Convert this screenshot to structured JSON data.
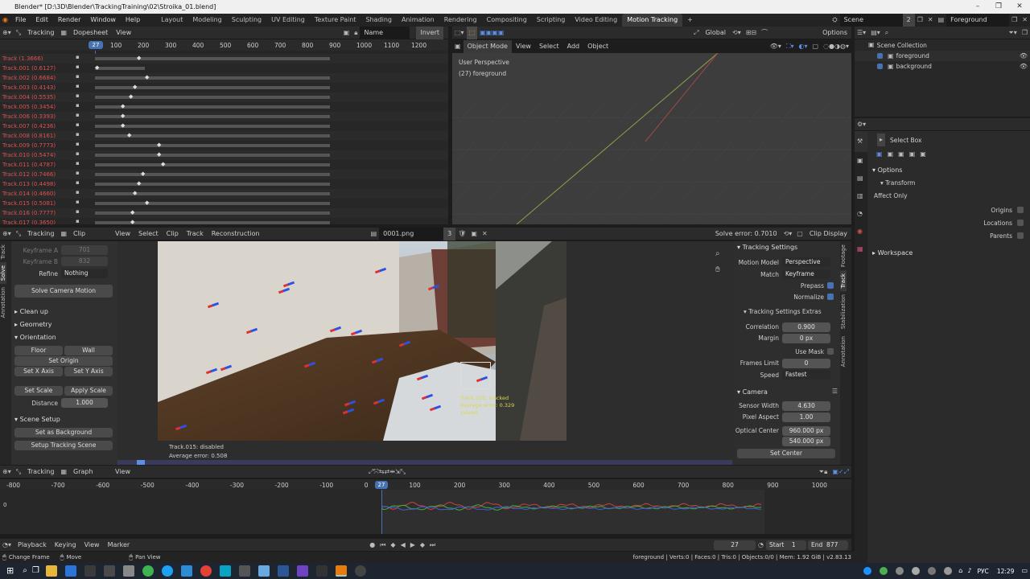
{
  "window": {
    "title": "Blender* [D:\\3D\\Blender\\TrackingTraining\\02\\Stroika_01.blend]"
  },
  "menu": [
    "File",
    "Edit",
    "Render",
    "Window",
    "Help"
  ],
  "workspaces": [
    "Layout",
    "Modeling",
    "Sculpting",
    "UV Editing",
    "Texture Paint",
    "Shading",
    "Animation",
    "Rendering",
    "Compositing",
    "Scripting",
    "Video Editing",
    "Motion Tracking"
  ],
  "active_workspace": "Motion Tracking",
  "scene": {
    "label": "Scene",
    "count": "2",
    "viewlayer": "Foreground"
  },
  "dopesheet": {
    "mode": "Tracking",
    "view": "Dopesheet",
    "view_menu": "View",
    "sort": "Name",
    "invert": "Invert",
    "frame_current": "27",
    "ticks": [
      "100",
      "200",
      "300",
      "400",
      "500",
      "600",
      "700",
      "800",
      "900",
      "1000",
      "1100",
      "1200"
    ],
    "tracks": [
      "Track (1.3666)",
      "Track.001 (0.6127)",
      "Track.002 (0.6684)",
      "Track.003 (0.4143)",
      "Track.004 (0.5535)",
      "Track.005 (0.3454)",
      "Track.006 (0.3393)",
      "Track.007 (0.4236)",
      "Track.008 (0.8161)",
      "Track.009 (0.7773)",
      "Track.010 (0.5474)",
      "Track.011 (0.4787)",
      "Track.012 (0.7466)",
      "Track.013 (0.4498)",
      "Track.014 (0.4660)",
      "Track.015 (0.5081)",
      "Track.016 (0.7777)",
      "Track.017 (0.3650)"
    ]
  },
  "viewport3d": {
    "mode": "Object Mode",
    "menus": [
      "View",
      "Select",
      "Add",
      "Object"
    ],
    "orientation": "Global",
    "options": "Options",
    "perspective_label": "User Perspective",
    "active_object": "(27) foreground"
  },
  "outliner": {
    "collection": "Scene Collection",
    "items": [
      "foreground",
      "background"
    ]
  },
  "properties": {
    "tool": "Select Box",
    "options_label": "Options",
    "transform_label": "Transform",
    "affect_only": "Affect Only",
    "origins": "Origins",
    "locations": "Locations",
    "parents": "Parents",
    "workspace": "Workspace"
  },
  "clip_editor": {
    "mode": "Tracking",
    "view": "Clip",
    "menus": [
      "View",
      "Select",
      "Clip",
      "Track",
      "Reconstruction"
    ],
    "clip_name": "0001.png",
    "users": "3",
    "solve_error": "Solve error: 0.7010",
    "display": "Clip Display",
    "overlay_track": "Track.015: disabled",
    "overlay_avg": "Average error: 0.508",
    "marker_label_1": "Track.025: tracked",
    "marker_label_2": "Average error: 0.329",
    "marker_label_3": "solved"
  },
  "solve_panel": {
    "keyframe_a": "Keyframe A",
    "keyframe_a_val": "701",
    "keyframe_b": "Keyframe B",
    "keyframe_b_val": "832",
    "refine": "Refine",
    "refine_val": "Nothing",
    "solve_btn": "Solve Camera Motion",
    "cleanup": "Clean up",
    "geometry": "Geometry",
    "orientation": "Orientation",
    "floor": "Floor",
    "wall": "Wall",
    "set_origin": "Set Origin",
    "set_x": "Set X Axis",
    "set_y": "Set Y Axis",
    "set_scale": "Set Scale",
    "apply_scale": "Apply Scale",
    "distance": "Distance",
    "distance_val": "1.000",
    "scene_setup": "Scene Setup",
    "set_bg": "Set as Background",
    "setup_scene": "Setup Tracking Scene",
    "vtabs": [
      "Track",
      "Solve",
      "Annotation"
    ]
  },
  "tracking_settings": {
    "title": "Tracking Settings",
    "motion_model": "Motion Model",
    "motion_model_val": "Perspective",
    "match": "Match",
    "match_val": "Keyframe",
    "prepass": "Prepass",
    "normalize": "Normalize",
    "extras": "Tracking Settings Extras",
    "correlation": "Correlation",
    "correlation_val": "0.900",
    "margin": "Margin",
    "margin_val": "0 px",
    "use_mask": "Use Mask",
    "frames_limit": "Frames Limit",
    "frames_limit_val": "0",
    "speed": "Speed",
    "speed_val": "Fastest",
    "camera": "Camera",
    "sensor_width": "Sensor Width",
    "sensor_width_val": "4.630",
    "pixel_aspect": "Pixel Aspect",
    "pixel_aspect_val": "1.00",
    "optical_center": "Optical Center",
    "oc_x": "960.000 px",
    "oc_y": "540.000 px",
    "set_center": "Set Center",
    "vtabs": [
      "Footage",
      "Track",
      "Stabilization",
      "Annotation"
    ]
  },
  "graph": {
    "mode": "Tracking",
    "view": "Graph",
    "view_menu": "View",
    "ticks": [
      "-800",
      "-700",
      "-600",
      "-500",
      "-400",
      "-300",
      "-200",
      "-100",
      "0",
      "100",
      "200",
      "300",
      "400",
      "500",
      "600",
      "700",
      "800",
      "900",
      "1000"
    ],
    "current": "27",
    "zero": "0"
  },
  "timeline": {
    "menus": [
      "Playback",
      "Keying",
      "View",
      "Marker"
    ],
    "current": "27",
    "start_label": "Start",
    "start": "1",
    "end_label": "End",
    "end": "877"
  },
  "statusbar": {
    "change_frame": "Change Frame",
    "move": "Move",
    "pan_view": "Pan View",
    "stats": "foreground | Verts:0 | Faces:0 | Tris:0 | Objects:0/0 | Mem: 1.92 GiB | v2.83.13"
  },
  "taskbar": {
    "lang": "РУС",
    "time": "12:29"
  },
  "colors": {
    "accent": "#4772b3",
    "track_red": "#e05050",
    "bg": "#1d1d1d"
  }
}
